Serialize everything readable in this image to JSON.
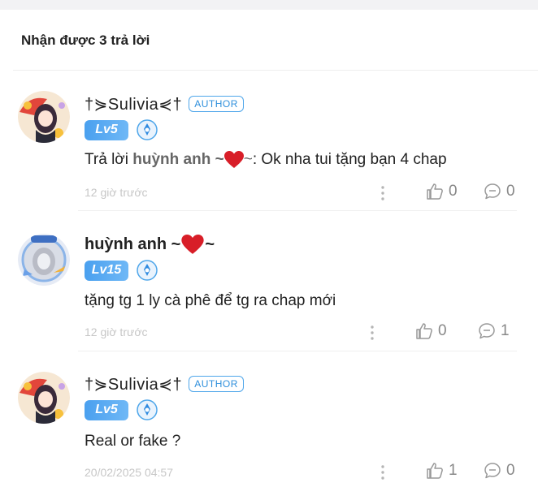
{
  "header": {
    "title": "Nhận được 3 trả lời"
  },
  "author_label": "AUTHOR",
  "comments": [
    {
      "user": "†⋟Sulivia⋞†",
      "level": "Lv5",
      "is_author": true,
      "reply_prefix": "Trả lời ",
      "reply_to": "huỳnh anh ~",
      "reply_to_suffix": "~",
      "body": ": Ok nha tui tặng bạn 4 chap",
      "time": "12 giờ trước",
      "likes": "0",
      "replies": "0"
    },
    {
      "user": "huỳnh anh ~",
      "user_suffix": "~",
      "level": "Lv15",
      "is_author": false,
      "body": "tặng tg 1 ly cà phê để tg ra chap mới",
      "time": "12 giờ trước",
      "likes": "0",
      "replies": "1"
    },
    {
      "user": "†⋟Sulivia⋞†",
      "level": "Lv5",
      "is_author": true,
      "body": "Real or fake ?",
      "time": "20/02/2025 04:57",
      "likes": "1",
      "replies": "0"
    }
  ],
  "colors": {
    "accent": "#4ea6ea",
    "heart": "#d81e28",
    "muted": "#c7c7c7"
  },
  "icons": [
    "more-vertical-icon",
    "like-thumb-icon",
    "comment-bubble-icon",
    "medal-icon",
    "heart-icon"
  ]
}
